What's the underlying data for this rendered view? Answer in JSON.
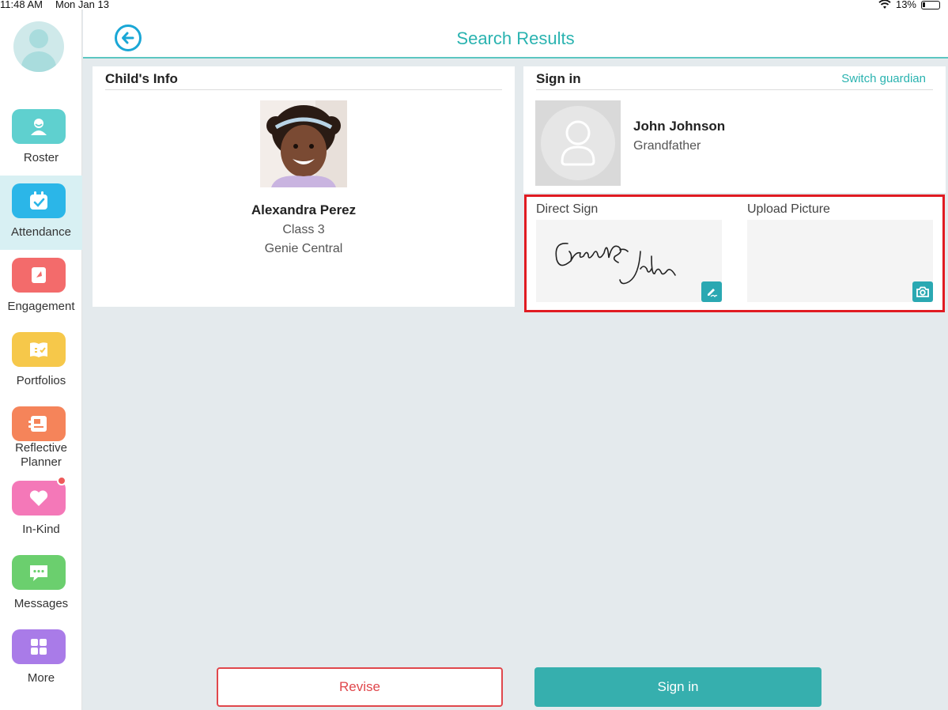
{
  "status_bar": {
    "time": "11:48 AM",
    "date": "Mon Jan 13",
    "battery": "13%"
  },
  "sidebar": {
    "items": [
      {
        "label": "Roster",
        "icon": "user-icon",
        "color": "#5fd0cf",
        "active": false
      },
      {
        "label": "Attendance",
        "icon": "calendar-check-icon",
        "color": "#2bb6e8",
        "active": true
      },
      {
        "label": "Engagement",
        "icon": "flag-icon",
        "color": "#f36b6b",
        "active": false
      },
      {
        "label": "Portfolios",
        "icon": "book-icon",
        "color": "#f6c84a",
        "active": false
      },
      {
        "label": "Reflective Planner",
        "icon": "planner-icon",
        "color": "#f5845a",
        "active": false
      },
      {
        "label": "In-Kind",
        "icon": "heart-icon",
        "color": "#f478b8",
        "active": false
      },
      {
        "label": "Messages",
        "icon": "chat-icon",
        "color": "#6bcf6e",
        "active": false
      },
      {
        "label": "More",
        "icon": "grid-icon",
        "color": "#a97be8",
        "active": false
      }
    ]
  },
  "header": {
    "title": "Search Results"
  },
  "child": {
    "section_title": "Child's Info",
    "name": "Alexandra Perez",
    "class": "Class 3",
    "center": "Genie Central"
  },
  "sign_in": {
    "section_title": "Sign in",
    "switch_label": "Switch guardian",
    "guardian_name": "John Johnson",
    "guardian_relation": "Grandfather",
    "direct_sign_label": "Direct Sign",
    "upload_picture_label": "Upload Picture"
  },
  "actions": {
    "revise_label": "Revise",
    "signin_label": "Sign in"
  },
  "colors": {
    "accent": "#2ab3b0",
    "highlight_border": "#e01b22",
    "revise": "#e0474c",
    "primary_button": "#36afae"
  }
}
